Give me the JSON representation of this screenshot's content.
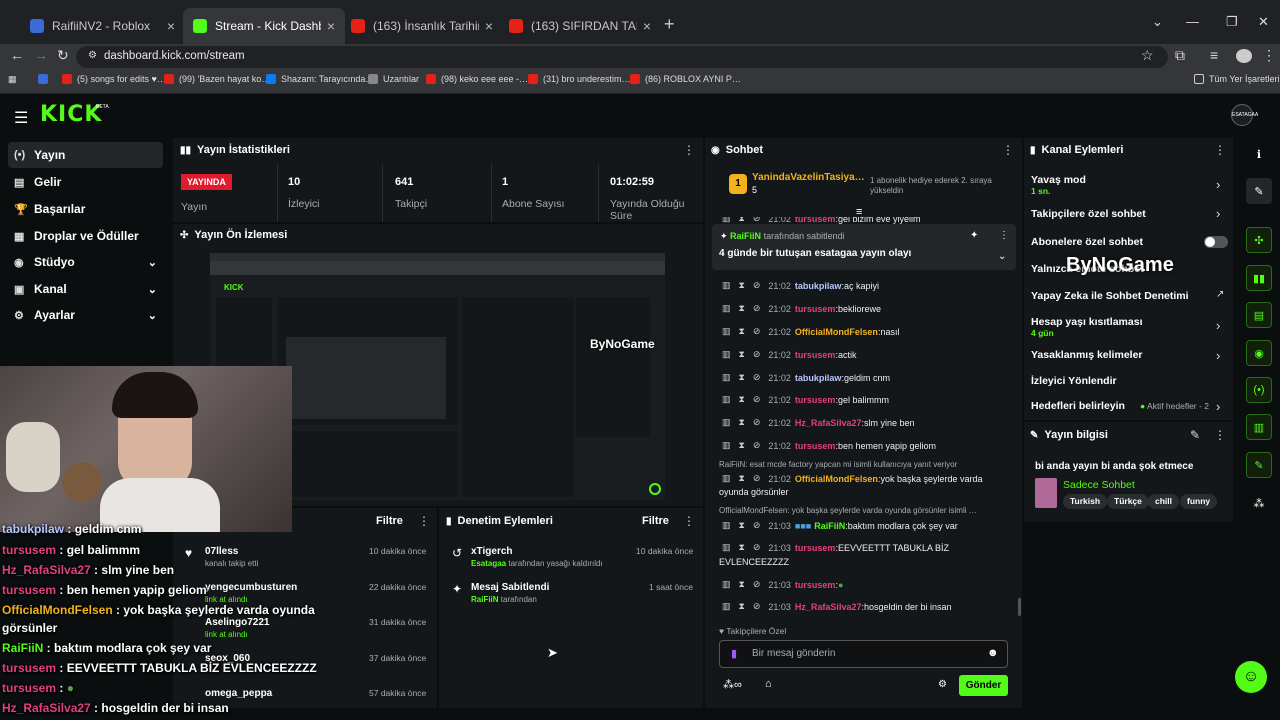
{
  "browser": {
    "tabs": [
      {
        "title": "RaifiiNV2 - Roblox",
        "fav": "#3a6bd8"
      },
      {
        "title": "Stream - Kick Dashboard",
        "fav": "#53fc18"
      },
      {
        "title": "(163) İnsanlık Tarihinin En Tehli…",
        "fav": "#e62117"
      },
      {
        "title": "(163) SIFIRDAN TARİKAT KURD…",
        "fav": "#e62117"
      }
    ],
    "url": "dashboard.kick.com/stream",
    "bookmarks": [
      "(5) songs for edits ♥…",
      "(99) 'Bazen hayat ko…",
      "Shazam: Tarayıcında…",
      "Uzantılar",
      "(98) keko eee eee -…",
      "(31) bro underestim…",
      "(86) ROBLOX AYNI P…"
    ],
    "all_bookmarks": "Tüm Yer İşaretleri"
  },
  "kick": {
    "logo": "KICK",
    "beta": "BETA",
    "avatar": "ESATAGAA"
  },
  "sidebar": {
    "items": [
      {
        "label": "Yayın",
        "icon": "(•)"
      },
      {
        "label": "Gelir",
        "icon": "▤"
      },
      {
        "label": "Başarılar",
        "icon": "🏆"
      },
      {
        "label": "Droplar ve Ödüller",
        "icon": "▦"
      },
      {
        "label": "Stüdyo",
        "icon": "◉"
      },
      {
        "label": "Kanal",
        "icon": "▣"
      },
      {
        "label": "Ayarlar",
        "icon": "⚙"
      }
    ]
  },
  "stats": {
    "title": "Yayın İstatistikleri",
    "live_badge": "YAYINDA",
    "live_label": "Yayın",
    "items": [
      {
        "value": "10",
        "label": "İzleyici"
      },
      {
        "value": "641",
        "label": "Takipçi"
      },
      {
        "value": "1",
        "label": "Abone Sayısı"
      },
      {
        "value": "01:02:59",
        "label": "Yayında Olduğu Süre"
      }
    ]
  },
  "preview": {
    "title": "Yayın Ön İzlemesi"
  },
  "overlay_chat": [
    {
      "user": "tabukpilaw",
      "color": "#b7c7ff",
      "msg": "geldim cnm"
    },
    {
      "user": "tursusem",
      "color": "#e0417a",
      "msg": "gel balimmm"
    },
    {
      "user": "Hz_RafaSilva27",
      "color": "#e0417a",
      "msg": "slm yine ben"
    },
    {
      "user": "tursusem",
      "color": "#e0417a",
      "msg": "ben hemen yapip geliom"
    },
    {
      "user": "OfficialMondFelsen",
      "color": "#f2b21b",
      "msg": "yok başka şeylerde varda oyunda"
    },
    {
      "user": "",
      "color": "#fff",
      "msg": "görsünler"
    },
    {
      "user": "RaiFiiN",
      "color": "#53fc18",
      "msg": "baktım modlara çok şey var"
    },
    {
      "user": "tursusem",
      "color": "#e0417a",
      "msg": "EEVVEETTT TABUKLA BİZ EVLENCEEZZZZ"
    },
    {
      "user": "tursusem",
      "color": "#e0417a",
      "msg": ""
    },
    {
      "user": "Hz_RafaSilva27",
      "color": "#e0417a",
      "msg": "hosgeldin der bi insan"
    }
  ],
  "activity": {
    "filter": "Filtre",
    "items": [
      {
        "name": "07lless",
        "sub": "kanalı takip etti",
        "time": "10 dakika önce"
      },
      {
        "name": "yengecumbusturen",
        "sub": "link at alındı",
        "time": "22 dakika önce"
      },
      {
        "name": "Aselingo7221",
        "sub": "link at alındı",
        "time": "31 dakika önce"
      },
      {
        "name": "seox_060",
        "sub": "",
        "time": "37 dakika önce"
      },
      {
        "name": "omega_peppa",
        "sub": "",
        "time": "57 dakika önce"
      }
    ]
  },
  "modlog": {
    "title": "Denetim Eylemleri",
    "filter": "Filtre",
    "items": [
      {
        "name": "xTigerch",
        "sub_user": "Esatagaa",
        "sub": "tarafından yasağı kaldırıldı",
        "time": "10 dakika önce"
      },
      {
        "name": "Mesaj Sabitlendi",
        "sub_user": "RaiFiiN",
        "sub": "tarafından",
        "time": "1 saat önce"
      }
    ]
  },
  "chat": {
    "title": "Sohbet",
    "gift_user": "YanindaVazelinTasiya…",
    "gift_count": "5",
    "gift_text": "1 abonelik hediye ederek 2. sıraya yükseldin",
    "pinned_by": "RaiFiiN",
    "pinned_suffix": "tarafından sabitlendi",
    "pinned_msg": "4 günde bir tutuşan esatagaa yayın olayı",
    "messages": [
      {
        "time": "21:02",
        "user": "tursusem",
        "color": "#e0417a",
        "msg": "gel bizim eve yiyelim"
      },
      {
        "time": "21:02",
        "user": "tabukpilaw",
        "color": "#b7c7ff",
        "msg": "aç kapiyi"
      },
      {
        "time": "21:02",
        "user": "tursusem",
        "color": "#e0417a",
        "msg": "bekliorewe"
      },
      {
        "time": "21:02",
        "user": "OfficialMondFelsen",
        "color": "#f2b21b",
        "msg": "nasıl"
      },
      {
        "time": "21:02",
        "user": "tursusem",
        "color": "#e0417a",
        "msg": "actik"
      },
      {
        "time": "21:02",
        "user": "tabukpilaw",
        "color": "#b7c7ff",
        "msg": "geldim cnm"
      },
      {
        "time": "21:02",
        "user": "tursusem",
        "color": "#e0417a",
        "msg": "gel balimmm"
      },
      {
        "time": "21:02",
        "user": "Hz_RafaSilva27",
        "color": "#e0417a",
        "msg": "slm yine ben"
      },
      {
        "time": "21:02",
        "user": "tursusem",
        "color": "#e0417a",
        "msg": "ben hemen yapip geliom"
      }
    ],
    "reply1": "RaiFiiN: esat mcde factory yapcan mi isimli kullanıcıya yanıt veriyor",
    "m10": {
      "time": "21:02",
      "user": "OfficialMondFelsen",
      "msg": "yok başka şeylerde varda",
      "msg2": "oyunda görsünler"
    },
    "reply2": "OfficialMondFelsen: yok başka şeylerde varda oyunda görsünler isimli …",
    "m11": {
      "time": "21:03",
      "user": "RaiFiiN",
      "msg": "baktım modlara çok şey var"
    },
    "m12": {
      "time": "21:03",
      "user": "tursusem",
      "msg": "EEVVEETTT TABUKLA BİZ",
      "msg2": "EVLENCEEZZZZ"
    },
    "m13": {
      "time": "21:03",
      "user": "tursusem"
    },
    "m14": {
      "time": "21:03",
      "user": "Hz_RafaSilva27",
      "msg": "hosgeldin der bi insan"
    },
    "followers_only": "Takipçilere Özel",
    "placeholder": "Bir mesaj gönderin",
    "send": "Gönder"
  },
  "actions": {
    "title": "Kanal Eylemleri",
    "items": [
      {
        "label": "Yavaş mod",
        "sub": "1 sn."
      },
      {
        "label": "Takipçilere özel sohbet",
        "sub": ""
      },
      {
        "label": "Abonelere özel sohbet",
        "sub": ""
      },
      {
        "label": "Yalnızca emote sohbet",
        "sub": ""
      },
      {
        "label": "Yapay Zeka ile Sohbet Denetimi",
        "sub": ""
      },
      {
        "label": "Hesap yaşı kısıtlaması",
        "sub": "4 gün"
      },
      {
        "label": "Yasaklanmış kelimeler",
        "sub": ""
      },
      {
        "label": "İzleyici Yönlendir",
        "sub": ""
      },
      {
        "label": "Hedefleri belirleyin",
        "sub": "Aktif hedefler - 2"
      }
    ]
  },
  "info": {
    "title": "Yayın bilgisi",
    "stream_title": "bi anda yayın bi anda şok etmece",
    "category": "Sadece Sohbet",
    "tags": [
      "Turkish",
      "Türkçe",
      "chill",
      "funny"
    ]
  },
  "watermark": "ByNoGame"
}
